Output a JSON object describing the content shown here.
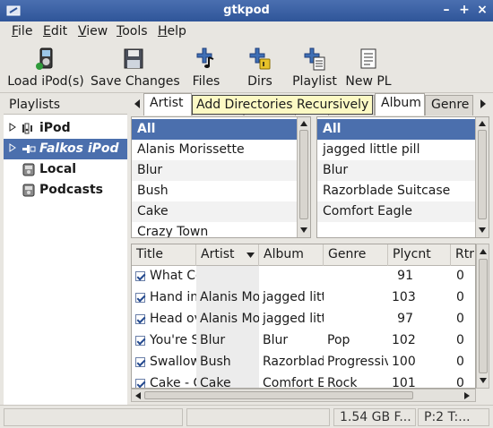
{
  "window": {
    "title": "gtkpod"
  },
  "menu": [
    {
      "key": "F",
      "rest": "ile"
    },
    {
      "key": "E",
      "rest": "dit"
    },
    {
      "key": "V",
      "rest": "iew"
    },
    {
      "key": "T",
      "rest": "ools"
    },
    {
      "key": "H",
      "rest": "elp"
    }
  ],
  "toolbar": {
    "load": "Load iPod(s)",
    "save": "Save Changes",
    "files": "Files",
    "dirs": "Dirs",
    "playlist": "Playlist",
    "new_pl": "New PL"
  },
  "playlists": {
    "header": "Playlists",
    "items": [
      "iPod",
      "Falkos iPod",
      "Local",
      "Podcasts"
    ]
  },
  "tabs": [
    "Artist",
    "Album",
    "Genre"
  ],
  "tooltip": "Add Directories Recursively",
  "artist_filter": [
    "All",
    "Alanis Morissette",
    "Blur",
    "Bush",
    "Cake",
    "Crazy Town"
  ],
  "album_filter": [
    "All",
    "jagged little pill",
    "Blur",
    "Razorblade Suitcase",
    "Comfort Eagle"
  ],
  "songs": {
    "columns": [
      "Title",
      "Artist",
      "Album",
      "Genre",
      "Plycnt",
      "Rtr"
    ],
    "rows": [
      {
        "title": "What Co",
        "artist": "",
        "album": "",
        "genre": "",
        "plycnt": "91",
        "rtr": "0"
      },
      {
        "title": "Hand in",
        "artist": "Alanis Mor",
        "album": "jagged littl",
        "genre": "",
        "plycnt": "103",
        "rtr": "0"
      },
      {
        "title": "Head ov",
        "artist": "Alanis Mor",
        "album": "jagged littl",
        "genre": "",
        "plycnt": "97",
        "rtr": "0"
      },
      {
        "title": "You're S",
        "artist": "Blur",
        "album": "Blur",
        "genre": "Pop",
        "plycnt": "102",
        "rtr": "0"
      },
      {
        "title": "Swallow",
        "artist": "Bush",
        "album": "Razorblade",
        "genre": "Progressiv",
        "plycnt": "100",
        "rtr": "0"
      },
      {
        "title": "Cake - C",
        "artist": "Cake",
        "album": "Comfort E",
        "genre": "Rock",
        "plycnt": "101",
        "rtr": "0"
      }
    ]
  },
  "status": {
    "space": "1.54 GB F...",
    "tracks": "P:2 T:..."
  },
  "colors": {
    "titlebar": "#3a62a8",
    "selection": "#4b6fad",
    "tooltip": "#fcf9c4"
  }
}
